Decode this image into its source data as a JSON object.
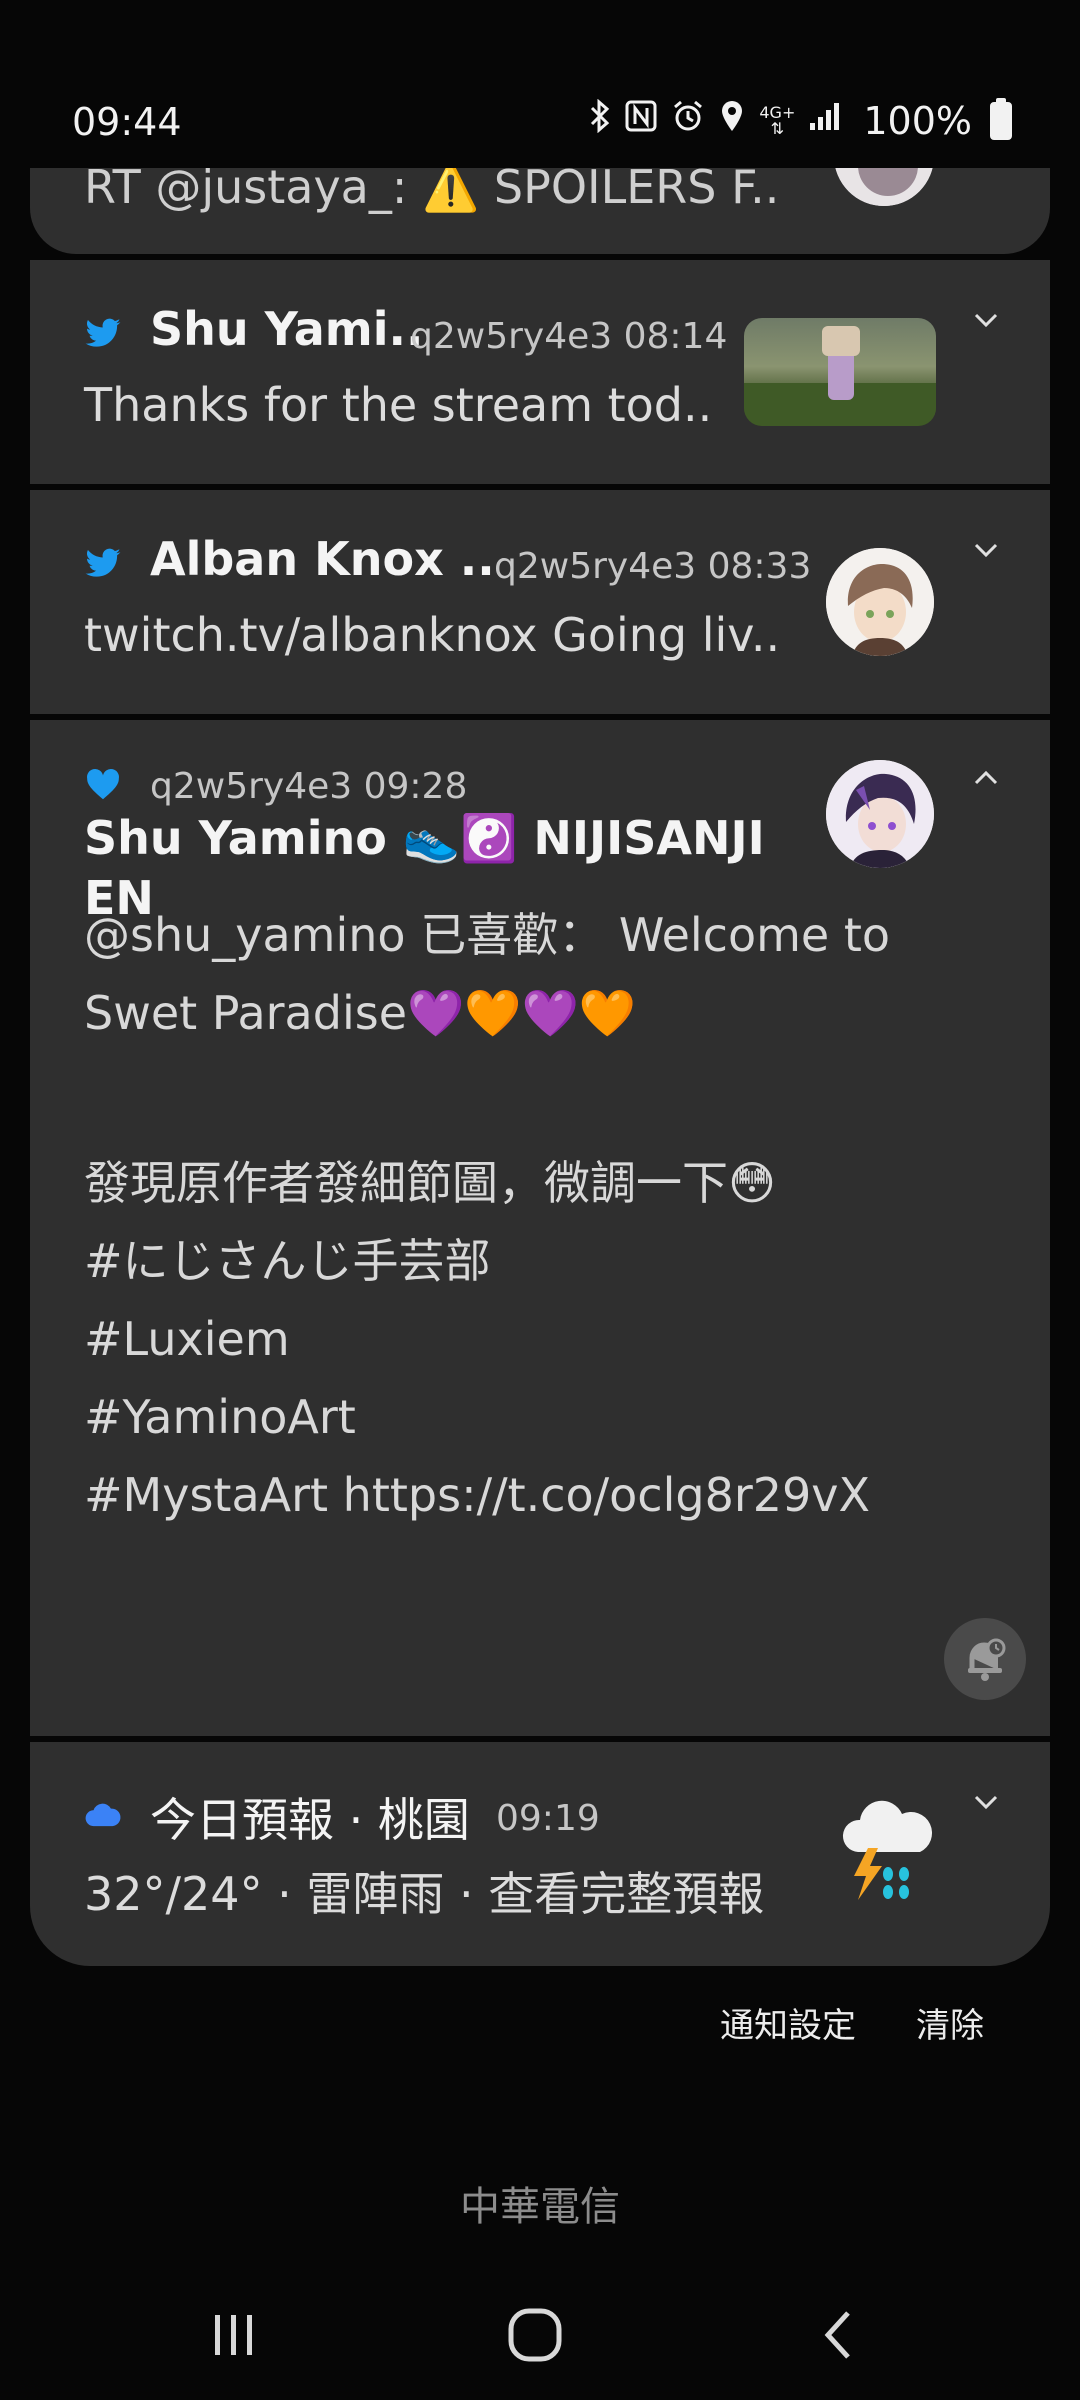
{
  "status_bar": {
    "time": "09:44",
    "network": "4G+",
    "battery": "100%"
  },
  "notifications": [
    {
      "id": "partial",
      "body": "RT @justaya_: ⚠️ SPOILERS F.."
    },
    {
      "id": "shu-retweet",
      "sender": "Shu Yami..",
      "account_time": "q2w5ry4e3 08:14",
      "body": "Thanks for the stream tod.."
    },
    {
      "id": "alban",
      "sender": "Alban Knox ..",
      "account_time": "q2w5ry4e3 08:33",
      "body": "twitch.tv/albanknox  Going liv.."
    },
    {
      "id": "like",
      "account_time": "q2w5ry4e3 09:28",
      "title": "Shu Yamino 👟☯️ NIJISANJI EN",
      "body_lines": [
        "@shu_yamino 已喜歡： Welcome to",
        "Swet Paradise💜🧡💜🧡",
        "",
        "發現原作者發細節圖，微調一下😳",
        "#にじさんじ手芸部",
        "#Luxiem",
        "#YaminoArt",
        "#MystaArt https://t.co/oclg8r29vX"
      ]
    },
    {
      "id": "weather",
      "sender": "今日預報 · 桃園",
      "time": "09:19",
      "body": "32°/24° · 雷陣雨 · 查看完整預報"
    }
  ],
  "actions": {
    "settings": "通知設定",
    "clear": "清除"
  },
  "carrier": "中華電信",
  "colors": {
    "panel": "#2f2f2f",
    "background": "#060606",
    "twitter_blue": "#1d9bf0",
    "weather_blue": "#3b82f6"
  }
}
